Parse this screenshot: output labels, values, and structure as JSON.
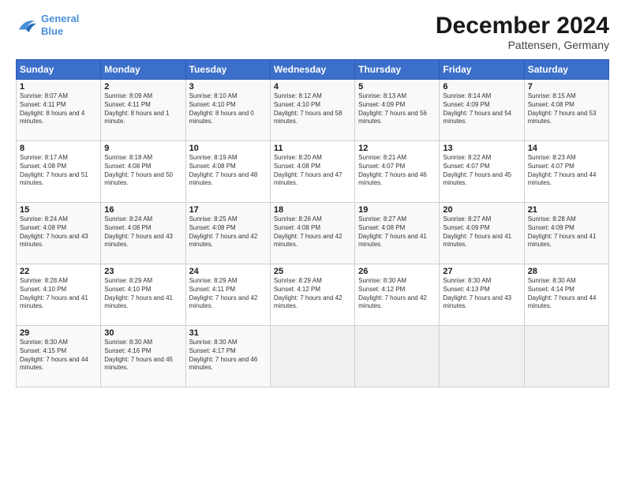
{
  "header": {
    "logo_line1": "General",
    "logo_line2": "Blue",
    "month": "December 2024",
    "location": "Pattensen, Germany"
  },
  "days_of_week": [
    "Sunday",
    "Monday",
    "Tuesday",
    "Wednesday",
    "Thursday",
    "Friday",
    "Saturday"
  ],
  "weeks": [
    [
      {
        "day": "1",
        "sunrise": "8:07 AM",
        "sunset": "4:11 PM",
        "daylight": "8 hours and 4 minutes"
      },
      {
        "day": "2",
        "sunrise": "8:09 AM",
        "sunset": "4:11 PM",
        "daylight": "8 hours and 1 minute"
      },
      {
        "day": "3",
        "sunrise": "8:10 AM",
        "sunset": "4:10 PM",
        "daylight": "8 hours and 0 minutes"
      },
      {
        "day": "4",
        "sunrise": "8:12 AM",
        "sunset": "4:10 PM",
        "daylight": "7 hours and 58 minutes"
      },
      {
        "day": "5",
        "sunrise": "8:13 AM",
        "sunset": "4:09 PM",
        "daylight": "7 hours and 56 minutes"
      },
      {
        "day": "6",
        "sunrise": "8:14 AM",
        "sunset": "4:09 PM",
        "daylight": "7 hours and 54 minutes"
      },
      {
        "day": "7",
        "sunrise": "8:15 AM",
        "sunset": "4:08 PM",
        "daylight": "7 hours and 53 minutes"
      }
    ],
    [
      {
        "day": "8",
        "sunrise": "8:17 AM",
        "sunset": "4:08 PM",
        "daylight": "7 hours and 51 minutes"
      },
      {
        "day": "9",
        "sunrise": "8:18 AM",
        "sunset": "4:08 PM",
        "daylight": "7 hours and 50 minutes"
      },
      {
        "day": "10",
        "sunrise": "8:19 AM",
        "sunset": "4:08 PM",
        "daylight": "7 hours and 48 minutes"
      },
      {
        "day": "11",
        "sunrise": "8:20 AM",
        "sunset": "4:08 PM",
        "daylight": "7 hours and 47 minutes"
      },
      {
        "day": "12",
        "sunrise": "8:21 AM",
        "sunset": "4:07 PM",
        "daylight": "7 hours and 46 minutes"
      },
      {
        "day": "13",
        "sunrise": "8:22 AM",
        "sunset": "4:07 PM",
        "daylight": "7 hours and 45 minutes"
      },
      {
        "day": "14",
        "sunrise": "8:23 AM",
        "sunset": "4:07 PM",
        "daylight": "7 hours and 44 minutes"
      }
    ],
    [
      {
        "day": "15",
        "sunrise": "8:24 AM",
        "sunset": "4:08 PM",
        "daylight": "7 hours and 43 minutes"
      },
      {
        "day": "16",
        "sunrise": "8:24 AM",
        "sunset": "4:08 PM",
        "daylight": "7 hours and 43 minutes"
      },
      {
        "day": "17",
        "sunrise": "8:25 AM",
        "sunset": "4:08 PM",
        "daylight": "7 hours and 42 minutes"
      },
      {
        "day": "18",
        "sunrise": "8:26 AM",
        "sunset": "4:08 PM",
        "daylight": "7 hours and 42 minutes"
      },
      {
        "day": "19",
        "sunrise": "8:27 AM",
        "sunset": "4:08 PM",
        "daylight": "7 hours and 41 minutes"
      },
      {
        "day": "20",
        "sunrise": "8:27 AM",
        "sunset": "4:09 PM",
        "daylight": "7 hours and 41 minutes"
      },
      {
        "day": "21",
        "sunrise": "8:28 AM",
        "sunset": "4:09 PM",
        "daylight": "7 hours and 41 minutes"
      }
    ],
    [
      {
        "day": "22",
        "sunrise": "8:28 AM",
        "sunset": "4:10 PM",
        "daylight": "7 hours and 41 minutes"
      },
      {
        "day": "23",
        "sunrise": "8:29 AM",
        "sunset": "4:10 PM",
        "daylight": "7 hours and 41 minutes"
      },
      {
        "day": "24",
        "sunrise": "8:29 AM",
        "sunset": "4:11 PM",
        "daylight": "7 hours and 42 minutes"
      },
      {
        "day": "25",
        "sunrise": "8:29 AM",
        "sunset": "4:12 PM",
        "daylight": "7 hours and 42 minutes"
      },
      {
        "day": "26",
        "sunrise": "8:30 AM",
        "sunset": "4:12 PM",
        "daylight": "7 hours and 42 minutes"
      },
      {
        "day": "27",
        "sunrise": "8:30 AM",
        "sunset": "4:13 PM",
        "daylight": "7 hours and 43 minutes"
      },
      {
        "day": "28",
        "sunrise": "8:30 AM",
        "sunset": "4:14 PM",
        "daylight": "7 hours and 44 minutes"
      }
    ],
    [
      {
        "day": "29",
        "sunrise": "8:30 AM",
        "sunset": "4:15 PM",
        "daylight": "7 hours and 44 minutes"
      },
      {
        "day": "30",
        "sunrise": "8:30 AM",
        "sunset": "4:16 PM",
        "daylight": "7 hours and 45 minutes"
      },
      {
        "day": "31",
        "sunrise": "8:30 AM",
        "sunset": "4:17 PM",
        "daylight": "7 hours and 46 minutes"
      },
      null,
      null,
      null,
      null
    ]
  ]
}
